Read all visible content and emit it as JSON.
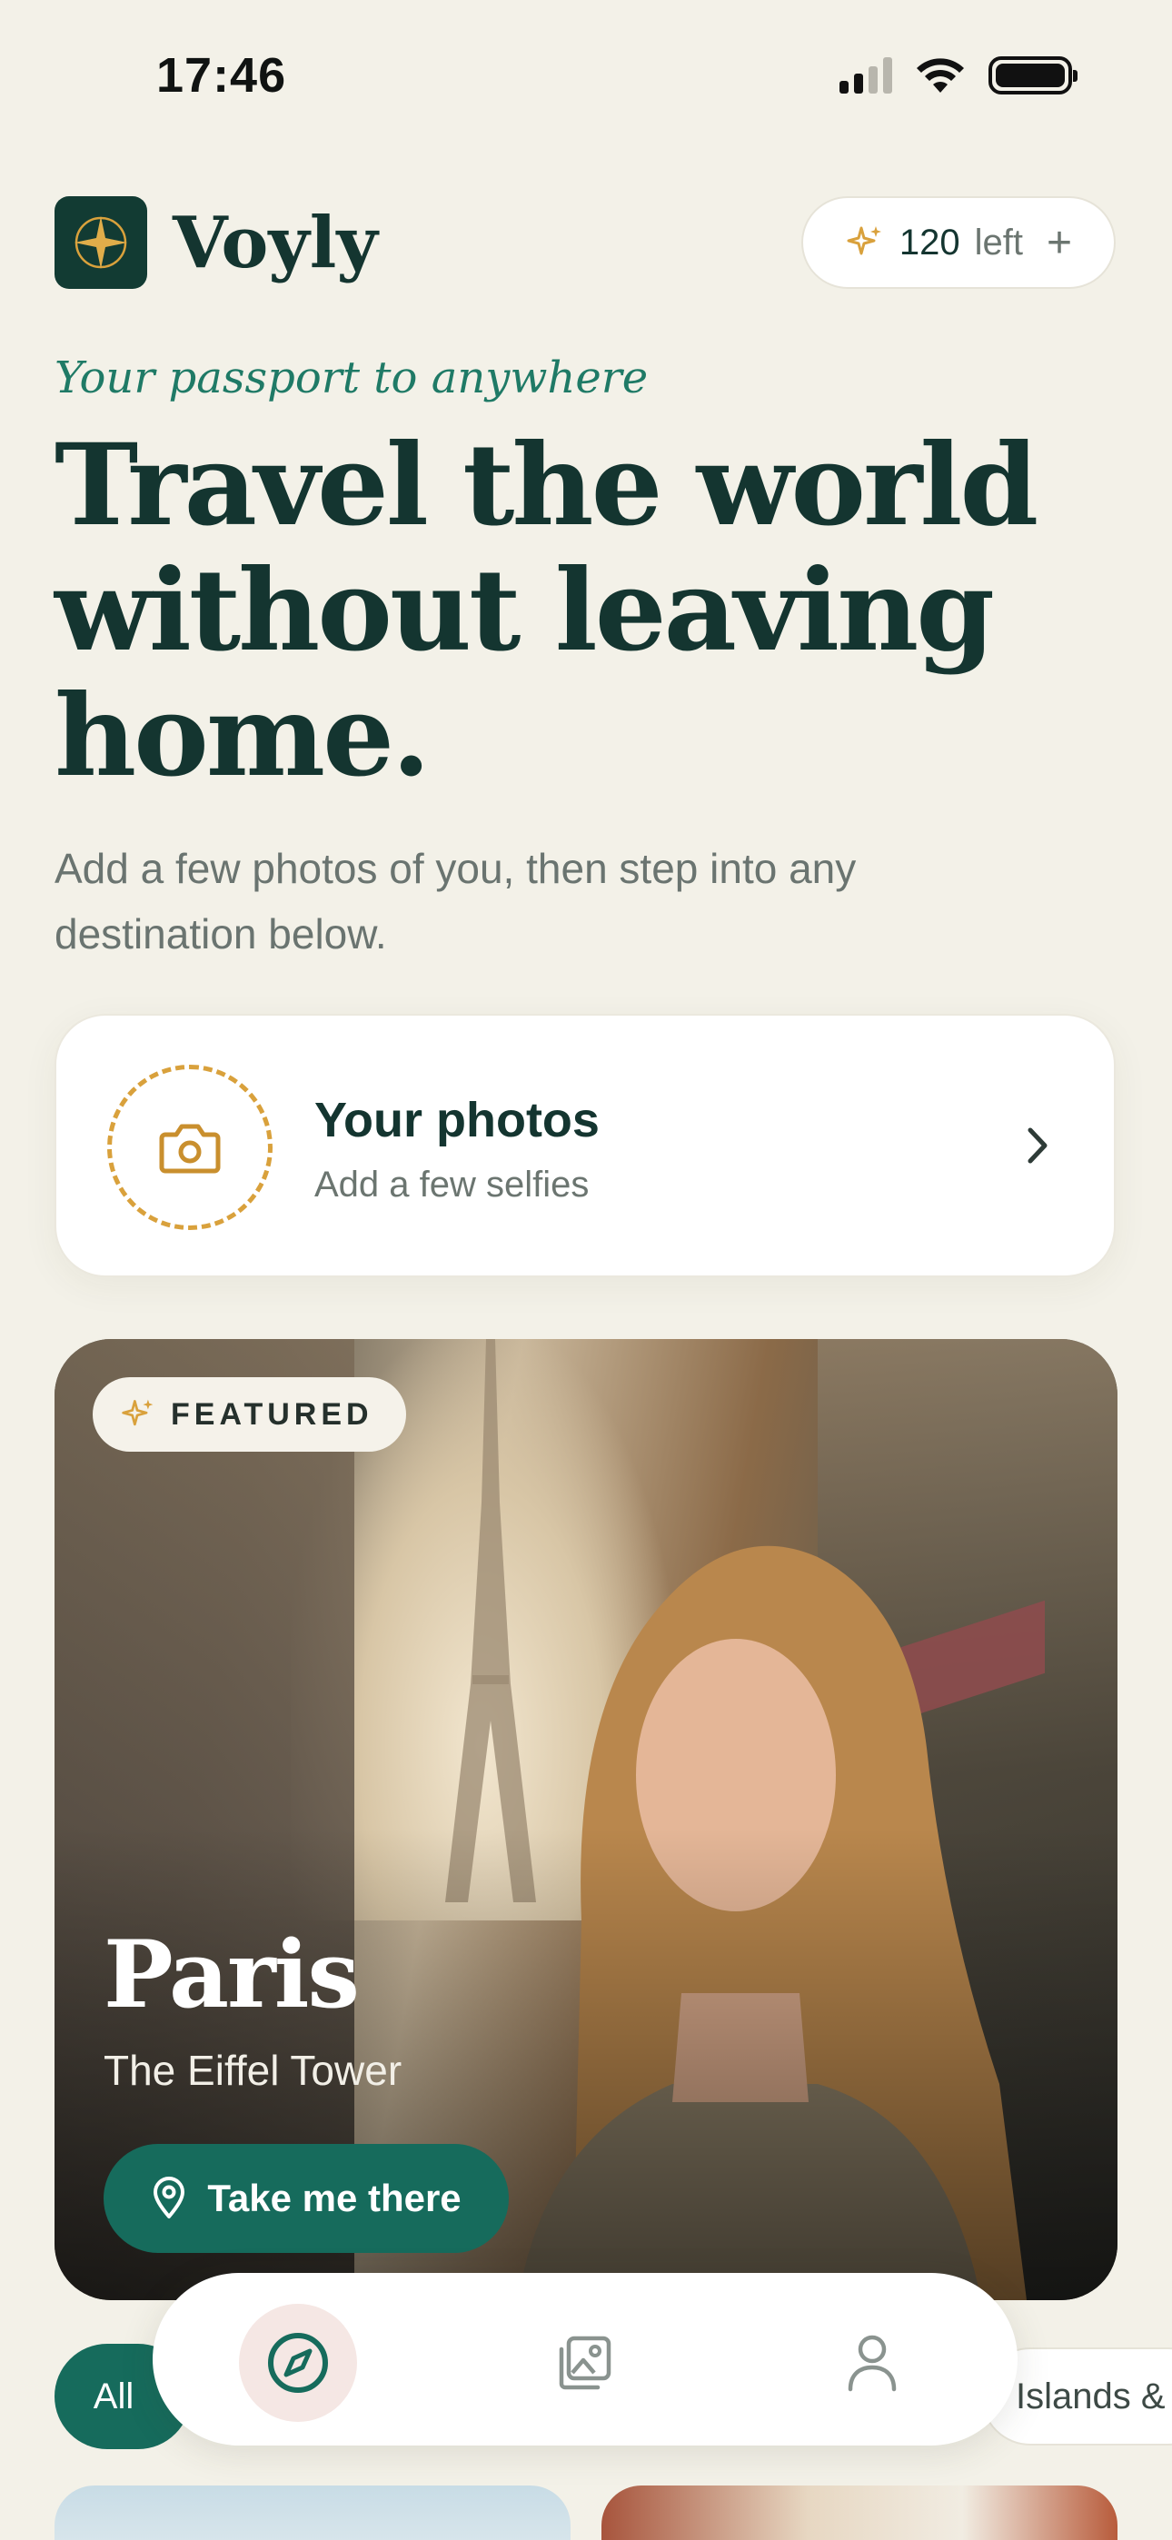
{
  "status_bar": {
    "time": "17:46"
  },
  "header": {
    "brand": "Voyly",
    "credits": {
      "count": "120",
      "label": "left",
      "add_symbol": "+"
    }
  },
  "hero": {
    "tagline": "Your passport to anywhere",
    "headline": "Travel the world without leaving home.",
    "subtext": "Add a few photos of you, then step into any destination below."
  },
  "photos_card": {
    "title": "Your photos",
    "subtitle": "Add a few selfies"
  },
  "featured": {
    "badge": "FEATURED",
    "city": "Paris",
    "landmark": "The Eiffel Tower",
    "cta": "Take me there"
  },
  "filters": {
    "chips": [
      "All",
      "Islands &"
    ]
  },
  "tabbar": {
    "tabs": [
      "explore-icon",
      "gallery-icon",
      "profile-icon"
    ],
    "active": "explore-icon"
  },
  "colors": {
    "accent": "#166b5c",
    "gold": "#d9a13c",
    "background": "#f3f1e8",
    "ink": "#143530"
  }
}
